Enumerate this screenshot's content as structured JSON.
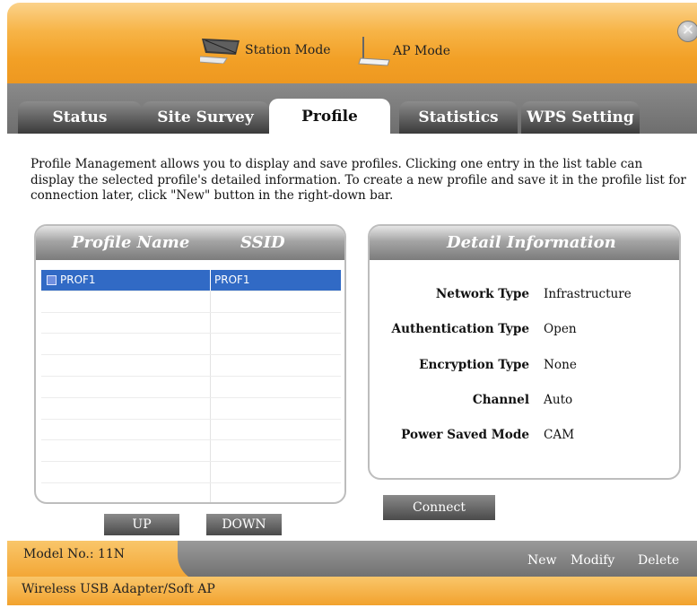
{
  "header": {
    "station_mode": "Station Mode",
    "ap_mode": "AP Mode",
    "close_glyph": "✕"
  },
  "tabs": [
    {
      "label": "Status"
    },
    {
      "label": "Site Survey"
    },
    {
      "label": "Profile",
      "active": true
    },
    {
      "label": "Statistics"
    },
    {
      "label": "WPS Setting"
    }
  ],
  "description": "Profile Management allows you to display and save profiles. Clicking one entry in the list table can display the selected profile's detailed information. To create a new profile and save it in the profile list for connection later, click \"New\" button in the right-down bar.",
  "profile_list": {
    "col_name": "Profile Name",
    "col_ssid": "SSID",
    "rows": [
      {
        "name": "PROF1",
        "ssid": "PROF1",
        "selected": true
      }
    ],
    "up_label": "UP",
    "down_label": "DOWN"
  },
  "detail": {
    "title": "Detail Information",
    "network_type_label": "Network Type",
    "network_type": "Infrastructure",
    "auth_type_label": "Authentication Type",
    "auth_type": "Open",
    "encryption_label": "Encryption Type",
    "encryption": "None",
    "channel_label": "Channel",
    "channel": "Auto",
    "power_label": "Power Saved Mode",
    "power": "CAM",
    "connect_label": "Connect"
  },
  "footer": {
    "model": "Model No.: 11N",
    "device": "Wireless USB Adapter/Soft AP",
    "new_label": "New",
    "modify_label": "Modify",
    "delete_label": "Delete"
  },
  "colors": {
    "accent_orange": "#f2a22e",
    "selection_blue": "#316ac5"
  }
}
